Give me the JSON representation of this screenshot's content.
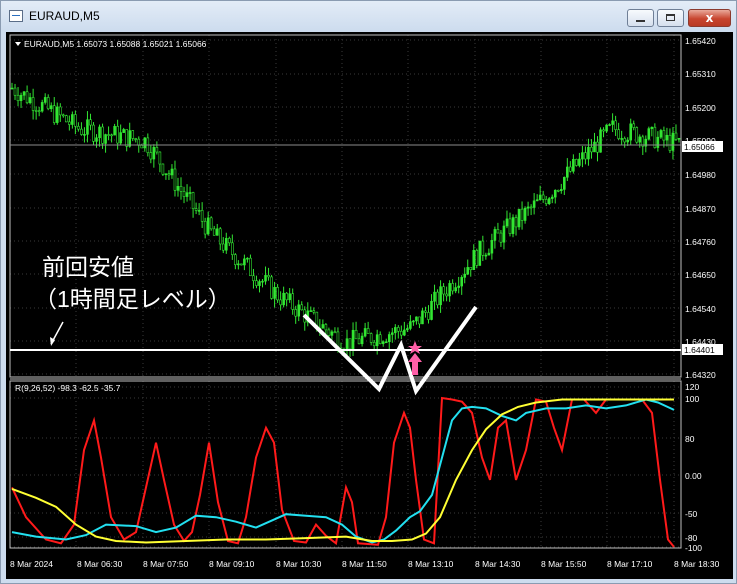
{
  "window": {
    "title": "EURAUD,M5",
    "close_glyph": "x",
    "icon": "chart-window-icon"
  },
  "header": {
    "symbol_text": "EURAUD,M5  1.65073 1.65088 1.65021 1.65066",
    "dropdown_icon": "triangle-down-icon"
  },
  "price_axis": {
    "ticks": [
      "1.65420",
      "1.65310",
      "1.65200",
      "1.65090",
      "1.64980",
      "1.64870",
      "1.64760",
      "1.64650",
      "1.64540",
      "1.64430",
      "1.64320"
    ],
    "current_price_label": "1.65066",
    "level_price_label": "1.64401"
  },
  "indicator": {
    "header_text": "R(9,26,52) -98.3 -62.5 -35.7",
    "ticks": [
      "120",
      "100",
      "80",
      "50",
      "0.00",
      "-50",
      "-80",
      "-100"
    ]
  },
  "time_axis": {
    "labels": [
      "8 Mar 2024",
      "8 Mar 06:30",
      "8 Mar 07:50",
      "8 Mar 09:10",
      "8 Mar 10:30",
      "8 Mar 11:50",
      "8 Mar 13:10",
      "8 Mar 14:30",
      "8 Mar 15:50",
      "8 Mar 17:10",
      "8 Mar 18:30"
    ]
  },
  "annotation": {
    "line1": "前回安値",
    "line2": "（1時間足レベル）"
  },
  "colors": {
    "candles": "#32e632",
    "indicator_red": "#ff1a1a",
    "indicator_cyan": "#22e0f0",
    "indicator_yellow": "#ffff33",
    "level_line": "#ffffff",
    "signal_arrow": "#ff5fa8",
    "grid": "#3a3a3a"
  },
  "chart_data": {
    "type": "line",
    "series": [
      {
        "name": "EURAUD,M5",
        "x": [
          "8 Mar 2024",
          "8 Mar 06:30",
          "8 Mar 07:50",
          "8 Mar 09:10",
          "8 Mar 10:30",
          "8 Mar 11:50",
          "8 Mar 13:10",
          "8 Mar 14:30",
          "8 Mar 15:50",
          "8 Mar 17:10",
          "8 Mar 18:30"
        ],
        "values": [
          1.6525,
          1.6512,
          1.6508,
          1.6478,
          1.6458,
          1.6443,
          1.6448,
          1.6472,
          1.649,
          1.6512,
          1.6507
        ]
      }
    ],
    "ylim": [
      1.6432,
      1.6542
    ]
  }
}
